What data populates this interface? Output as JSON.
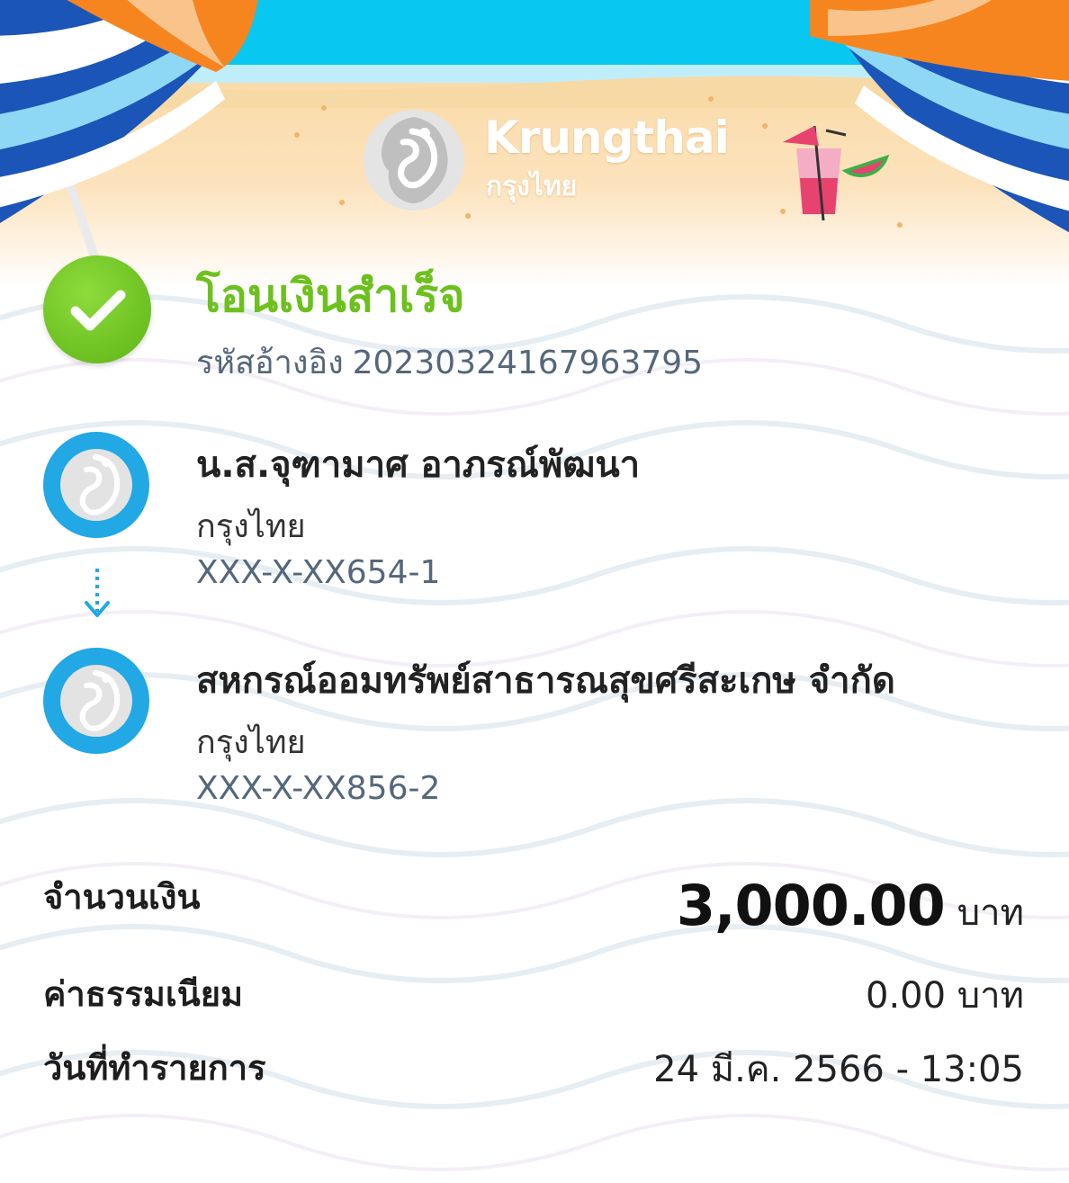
{
  "brand": {
    "name_en": "Krungthai",
    "name_th": "กรุงไทย",
    "colors": {
      "primary": "#21a8e5",
      "success": "#6cc11c"
    }
  },
  "status": {
    "title": "โอนเงินสำเร็จ",
    "ref_label": "รหัสอ้างอิง",
    "ref_value": "20230324167963795",
    "icon": "check-circle-icon"
  },
  "sender": {
    "name": "น.ส.จุฑามาศ อาภรณ์พัฒนา",
    "bank": "กรุงไทย",
    "account": "XXX-X-XX654-1",
    "icon": "krungthai-bird-icon"
  },
  "transfer_arrow_icon": "arrow-down-icon",
  "receiver": {
    "name": "สหกรณ์ออมทรัพย์สาธารณสุขศรีสะเกษ จำกัด",
    "bank": "กรุงไทย",
    "account": "XXX-X-XX856-2",
    "icon": "krungthai-bird-icon"
  },
  "summary": {
    "amount_label": "จำนวนเงิน",
    "amount_value": "3,000.00",
    "amount_unit": "บาท",
    "fee_label": "ค่าธรรมเนียม",
    "fee_value": "0.00 บาท",
    "date_label": "วันที่ทำรายการ",
    "date_value": "24 มี.ค. 2566 - 13:05"
  }
}
